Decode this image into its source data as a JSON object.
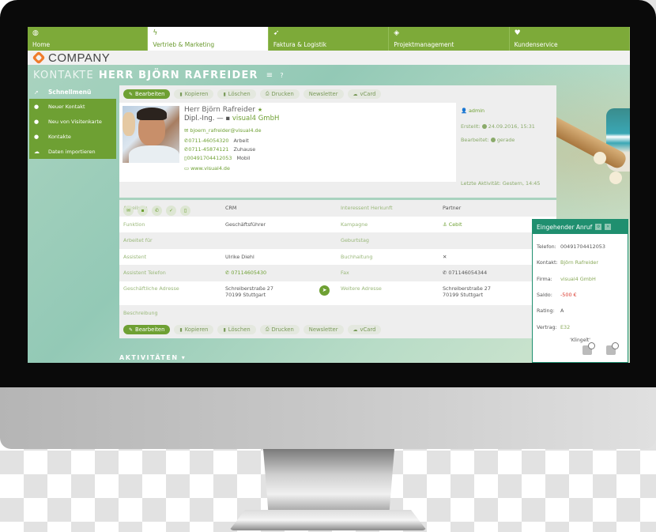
{
  "nav": {
    "tabs": [
      {
        "label": "Home",
        "icon": "globe-icon",
        "glyph": "◍",
        "active": false
      },
      {
        "label": "Vertrieb & Marketing",
        "icon": "lightning-icon",
        "glyph": "ϟ",
        "active": true
      },
      {
        "label": "Faktura & Logistik",
        "icon": "paper-plane-icon",
        "glyph": "➹",
        "active": false
      },
      {
        "label": "Projektmanagement",
        "icon": "cube-icon",
        "glyph": "◈",
        "active": false
      },
      {
        "label": "Kundenservice",
        "icon": "heart-icon",
        "glyph": "♥",
        "active": false
      }
    ]
  },
  "brand": {
    "name": "COMPANY",
    "logo_color": "#ef7c2b"
  },
  "header": {
    "section": "KONTAKTE",
    "title": "HERR BJÖRN RAFREIDER",
    "menu_glyph": "≡",
    "help_glyph": "?"
  },
  "sidebar": {
    "head": {
      "label": "Schnellmenü",
      "glyph": "➚"
    },
    "items": [
      {
        "label": "Neuer Kontakt",
        "glyph": "👤"
      },
      {
        "label": "Neu von Visitenkarte",
        "glyph": "👤"
      },
      {
        "label": "Kontakte",
        "glyph": "👤"
      },
      {
        "label": "Daten importieren",
        "glyph": "☁"
      }
    ]
  },
  "toolbar": {
    "buttons": [
      {
        "label": "Bearbeiten",
        "glyph": "✎",
        "primary": true
      },
      {
        "label": "Kopieren",
        "glyph": "▮",
        "primary": false
      },
      {
        "label": "Löschen",
        "glyph": "▮",
        "primary": false
      },
      {
        "label": "Drucken",
        "glyph": "⎙",
        "primary": false
      },
      {
        "label": "Newsletter",
        "glyph": "",
        "primary": false
      },
      {
        "label": "vCard",
        "glyph": "☁",
        "primary": false
      }
    ]
  },
  "contact": {
    "name": "Herr Björn Rafreider",
    "star": "★",
    "title": "Dipl.-Ing.",
    "separator": "—",
    "company": "visual4 GmbH",
    "email": "bjoern_rafreider@visual4.de",
    "phones": [
      {
        "number": "0711-46054320",
        "type": "Arbeit",
        "glyph": "✆"
      },
      {
        "number": "0711-45874121",
        "type": "Zuhause",
        "glyph": "✆"
      },
      {
        "number": "00491704412053",
        "type": "Mobil",
        "glyph": "▯"
      }
    ],
    "website": "www.visual4.de",
    "actions": [
      {
        "name": "email",
        "glyph": "✉"
      },
      {
        "name": "briefcase",
        "glyph": "▪"
      },
      {
        "name": "phone",
        "glyph": "✆"
      },
      {
        "name": "check",
        "glyph": "✓"
      },
      {
        "name": "document",
        "glyph": "▯"
      }
    ]
  },
  "meta": {
    "owner": "admin",
    "created_label": "Erstellt:",
    "created_value": "24.09.2016, 15:31",
    "edited_label": "Bearbeitet:",
    "edited_value": "gerade",
    "last_activity": "Letzte Aktivität: Gestern, 14:45"
  },
  "fields": [
    {
      "label1": "Abteilung",
      "value1": "CRM",
      "label2": "Interessent Herkunft",
      "value2": "Partner"
    },
    {
      "label1": "Funktion",
      "value1": "Geschäftsführer",
      "label2": "Kampagne",
      "value2": "⚓ Cebit"
    },
    {
      "label1": "Arbeitet für",
      "value1": "",
      "label2": "Geburtstag",
      "value2": ""
    },
    {
      "label1": "Assistent",
      "value1": "Ulrike Diehl",
      "label2": "Buchhaltung",
      "value2": "✕"
    },
    {
      "label1": "Assistent Telefon",
      "value1": "✆ 07114605430",
      "label2": "Fax",
      "value2": "✆ 071146054344"
    }
  ],
  "address": {
    "label1": "Geschäftliche Adresse",
    "line1": "Schreiberstraße 27",
    "line2": "70199 Stuttgart",
    "label2": "Weitere Adresse",
    "line1b": "Schreiberstraße 27",
    "line2b": "70199 Stuttgart"
  },
  "description_label": "Beschreibung",
  "activities_label": "AKTIVITÄTEN ▾",
  "call": {
    "title": "Eingehender Anruf",
    "rows": [
      {
        "label": "Telefon:",
        "value": "00491704412053",
        "style": ""
      },
      {
        "label": "Kontakt:",
        "value": "Björn Rafreider",
        "style": "green"
      },
      {
        "label": "Firma:",
        "value": "visual4 GmbH",
        "style": "green"
      },
      {
        "label": "Saldo:",
        "value": "-500 €",
        "style": "red"
      },
      {
        "label": "Rating:",
        "value": "A",
        "style": ""
      },
      {
        "label": "Vertrag:",
        "value": "E32",
        "style": "green"
      }
    ],
    "status": "'Klingelt'"
  },
  "colors": {
    "accent": "#6ea033",
    "nav": "#7daa39",
    "call_header": "#1f8f6f",
    "negative": "#d9372b"
  }
}
